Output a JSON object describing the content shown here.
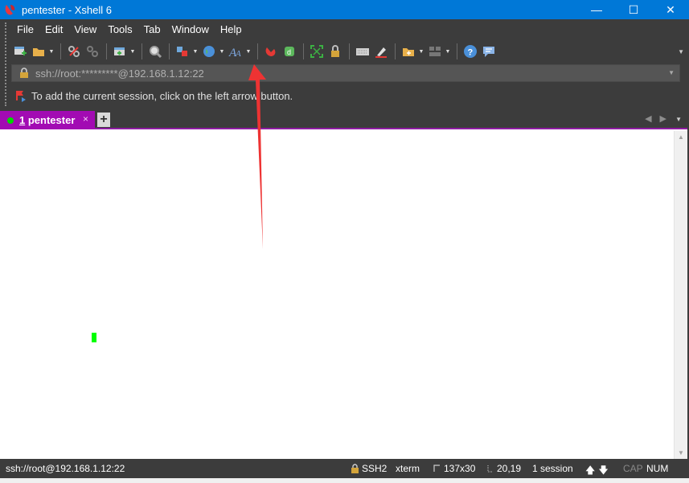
{
  "window": {
    "title": "pentester - Xshell 6",
    "minimize": "—",
    "maximize": "☐",
    "close": "✕"
  },
  "menu": [
    "File",
    "Edit",
    "View",
    "Tools",
    "Tab",
    "Window",
    "Help"
  ],
  "toolbar": {
    "icons": [
      "new-session-icon",
      "open-folder-icon",
      "reconnect-icon",
      "disconnect-icon",
      "new-tab-icon",
      "find-icon",
      "transfer-icon",
      "globe-icon",
      "font-icon",
      "xftp-icon",
      "xagent-icon",
      "fullscreen-icon",
      "lock-icon",
      "keyboard-icon",
      "highlight-icon",
      "compose-icon",
      "layout-icon",
      "help-icon",
      "chat-icon"
    ]
  },
  "address": {
    "value": "ssh://root:*********@192.168.1.12:22"
  },
  "hint": {
    "text": "To add the current session, click on the left arrow button."
  },
  "tabs": [
    {
      "number": "1",
      "name": "pentester",
      "status_color": "#00d800"
    }
  ],
  "tab_close": "×",
  "tab_add": "+",
  "status": {
    "connection": "ssh://root@192.168.1.12:22",
    "protocol": "SSH2",
    "terminal": "xterm",
    "size": "137x30",
    "position": "20,19",
    "sessions": "1 session",
    "caps": "CAP",
    "num": "NUM"
  },
  "colors": {
    "titlebar": "#0078d7",
    "chrome": "#3c3c3c",
    "tab_active": "#a20bb3",
    "cursor": "#00ff00",
    "annotation_arrow": "#ee3333"
  }
}
